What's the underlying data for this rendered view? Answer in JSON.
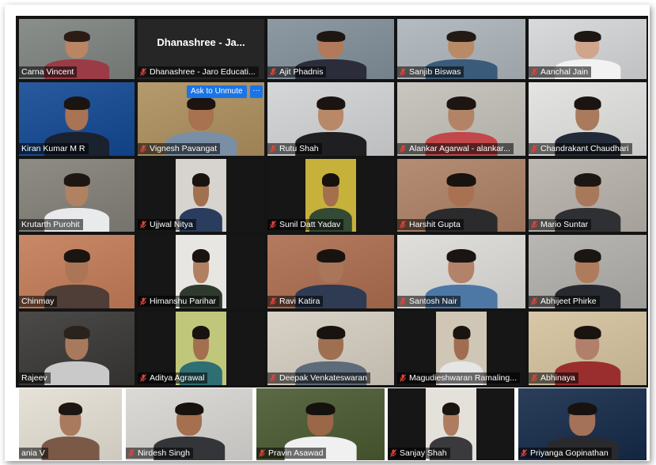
{
  "meeting": {
    "tiles": [
      {
        "name": "Carna Vincent",
        "muted": false,
        "bg": "#8a8f8c",
        "skin": "#b98565",
        "shirt": "#9b3b45",
        "hair": "#2b1c15",
        "video": true
      },
      {
        "name": "Dhanashree - Jaro Educati...",
        "muted": true,
        "bg": "#262626",
        "video": false,
        "display_title": "Dhanashree - Ja..."
      },
      {
        "name": "Ajit Phadnis",
        "muted": true,
        "bg": "#8e9aa3",
        "skin": "#b27a5a",
        "shirt": "#2b2e3a",
        "hair": "#1e1612",
        "video": true
      },
      {
        "name": "Sanjib Biswas",
        "muted": true,
        "bg": "#b5bcc1",
        "skin": "#b98a66",
        "shirt": "#3a5b7a",
        "hair": "#231a15",
        "video": true
      },
      {
        "name": "Aanchal Jain",
        "muted": true,
        "bg": "#d9dadb",
        "skin": "#d0a58c",
        "shirt": "#f2f2f2",
        "hair": "#1d1714",
        "video": true
      },
      {
        "name": "Kiran Kumar M R",
        "muted": false,
        "bg": "#2a5a9e",
        "skin": "#a87454",
        "shirt": "#1a2230",
        "hair": "#1b1512",
        "video": true
      },
      {
        "name": "Vignesh Pavangat",
        "muted": true,
        "bg": "#b49a6d",
        "skin": "#a8714f",
        "shirt": "#7a8fa6",
        "hair": "#1b1410",
        "video": true
      },
      {
        "name": "Rutu Shah",
        "muted": true,
        "bg": "#d5d7d8",
        "skin": "#b98868",
        "shirt": "#1f1f22",
        "hair": "#1a1412",
        "video": true
      },
      {
        "name": "Alankar Agarwal - alankar...",
        "muted": true,
        "bg": "#c9c6c0",
        "skin": "#b38366",
        "shirt": "#c2474a",
        "hair": "#1c1512",
        "video": true
      },
      {
        "name": "Chandrakant Chaudhari",
        "muted": true,
        "bg": "#e4e4e2",
        "skin": "#a97a5c",
        "shirt": "#232a37",
        "hair": "#1a1512",
        "video": true
      },
      {
        "name": "Krutarth Purohit",
        "muted": false,
        "bg": "#8f8c86",
        "skin": "#b08262",
        "shirt": "#e9eaeb",
        "hair": "#1d1612",
        "video": true
      },
      {
        "name": "Ujjwal Nitya",
        "muted": true,
        "bg": "#d7d4cf",
        "skin": "#a1704f",
        "shirt": "#2b3d5e",
        "hair": "#1a1411",
        "video": true,
        "narrow": true
      },
      {
        "name": "Sunil Datt Yadav",
        "muted": true,
        "bg": "#c6b13a",
        "skin": "#a56f4d",
        "shirt": "#344a35",
        "hair": "#17120f",
        "video": true,
        "narrow": true
      },
      {
        "name": "Harshit Gupta",
        "muted": true,
        "bg": "#b58d74",
        "skin": "#a77152",
        "shirt": "#2b2b2e",
        "hair": "#18130f",
        "video": true
      },
      {
        "name": "Mario Suntar",
        "muted": true,
        "bg": "#bfb9b3",
        "skin": "#a8785a",
        "shirt": "#2f3033",
        "hair": "#1d1713",
        "video": true
      },
      {
        "name": "Chinmay",
        "muted": false,
        "bg": "#c98968",
        "skin": "#ab7656",
        "shirt": "#4e3e37",
        "hair": "#1b1511",
        "video": true
      },
      {
        "name": "Himanshu Parihar",
        "muted": true,
        "bg": "#e8e6e2",
        "skin": "#b08060",
        "shirt": "#2f3a2f",
        "hair": "#191410",
        "video": true,
        "narrow": true
      },
      {
        "name": "Ravi Katira",
        "muted": true,
        "bg": "#b47b60",
        "skin": "#a9765a",
        "shirt": "#2e3b52",
        "hair": "#19130f",
        "video": true
      },
      {
        "name": "Santosh Nair",
        "muted": true,
        "bg": "#e0dfdc",
        "skin": "#b2836a",
        "shirt": "#4d78a6",
        "hair": "#1a1512",
        "video": true
      },
      {
        "name": "Abhijeet Phirke",
        "muted": true,
        "bg": "#b9b7b4",
        "skin": "#ae7c5c",
        "shirt": "#262a30",
        "hair": "#1c1612",
        "video": true
      },
      {
        "name": "Rajeev",
        "muted": false,
        "bg": "#4b4a48",
        "skin": "#a87a5d",
        "shirt": "#c9c9c9",
        "hair": "#2a221d",
        "video": true
      },
      {
        "name": "Aditya Agrawal",
        "muted": true,
        "bg": "#c0c77a",
        "skin": "#a46f4f",
        "shirt": "#2f6f73",
        "hair": "#18130f",
        "video": true,
        "narrow": true
      },
      {
        "name": "Deepak Venkateswaran",
        "muted": true,
        "bg": "#d9d3c7",
        "skin": "#9f6f52",
        "shirt": "#5d6b7a",
        "hair": "#18130f",
        "video": true
      },
      {
        "name": "Magudieshwaran Ramaling...",
        "muted": true,
        "bg": "#cfc6b6",
        "skin": "#a06d4f",
        "shirt": "#e5e5e5",
        "hair": "#1a1410",
        "video": true,
        "narrow": true
      },
      {
        "name": "Abhinaya",
        "muted": true,
        "bg": "#d8c8a8",
        "skin": "#b2806a",
        "shirt": "#9a2e2e",
        "hair": "#1a1411",
        "video": true
      },
      {
        "name": "ania V",
        "muted": false,
        "bg": "#e6e2d8",
        "skin": "#a97a5e",
        "shirt": "#7a5a46",
        "hair": "#1d1612",
        "video": true
      },
      {
        "name": "Nirdesh Singh",
        "muted": true,
        "bg": "#dcdad6",
        "skin": "#a4704f",
        "shirt": "#333538",
        "hair": "#18120f",
        "video": true
      },
      {
        "name": "Pravin Asawad",
        "muted": true,
        "bg": "#5b6a45",
        "skin": "#9a6748",
        "shirt": "#f0f0f0",
        "hair": "#15110e",
        "video": true
      },
      {
        "name": "Sanjay Shah",
        "muted": true,
        "bg": "#e4e1db",
        "skin": "#ae7d5f",
        "shirt": "#3a3a3c",
        "hair": "#1b1511",
        "video": true,
        "narrow": true
      },
      {
        "name": "Priyanga Gopinathan",
        "muted": true,
        "bg": "#2b3e5a",
        "skin": "#a47258",
        "shirt": "#2a2a2e",
        "hair": "#17120f",
        "video": true
      }
    ],
    "overlay": {
      "ask_to_unmute_label": "Ask to Unmute",
      "more_label": "···"
    },
    "mute_icon": "muted-microphone-icon",
    "accent_color": "#1a74e8",
    "muted_color": "#e0443a"
  }
}
